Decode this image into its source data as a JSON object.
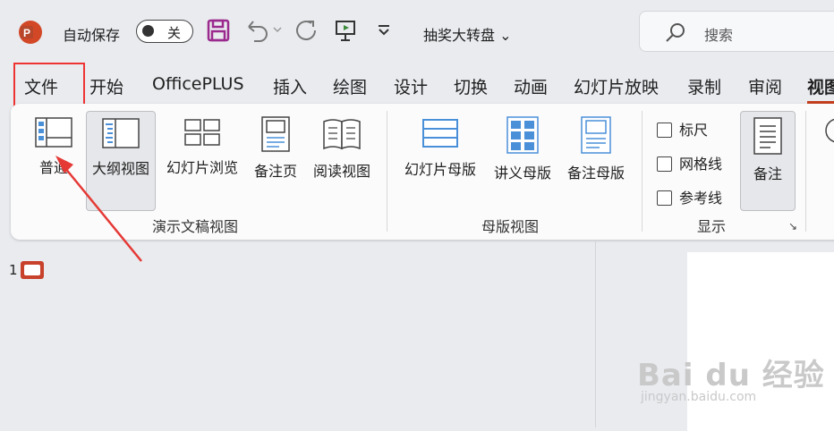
{
  "titlebar": {
    "autosave_label": "自动保存",
    "autosave_toggle": "关",
    "doc_name": "抽奖大转盘 ⌄",
    "search_placeholder": "搜索"
  },
  "tabs": [
    "文件",
    "开始",
    "OfficePLUS",
    "插入",
    "绘图",
    "设计",
    "切换",
    "动画",
    "幻灯片放映",
    "录制",
    "审阅",
    "视图"
  ],
  "active_tab": "视图",
  "ribbon": {
    "presentation_views": {
      "label": "演示文稿视图",
      "buttons": [
        "普通",
        "大纲视图",
        "幻灯片浏览",
        "备注页",
        "阅读视图"
      ],
      "selected": "大纲视图"
    },
    "master_views": {
      "label": "母版视图",
      "buttons": [
        "幻灯片母版",
        "讲义母版",
        "备注母版"
      ]
    },
    "show": {
      "label": "显示",
      "checkboxes": [
        "标尺",
        "网格线",
        "参考线"
      ],
      "notes_button": "备注"
    }
  },
  "thumbnail_pane": {
    "slide_number": "1"
  },
  "watermark": {
    "text": "Bai du 经验",
    "sub": "jingyan.baidu.com"
  },
  "colors": {
    "accent": "#c43e1c",
    "highlight_box": "#e33333",
    "background": "#e9ebef"
  }
}
